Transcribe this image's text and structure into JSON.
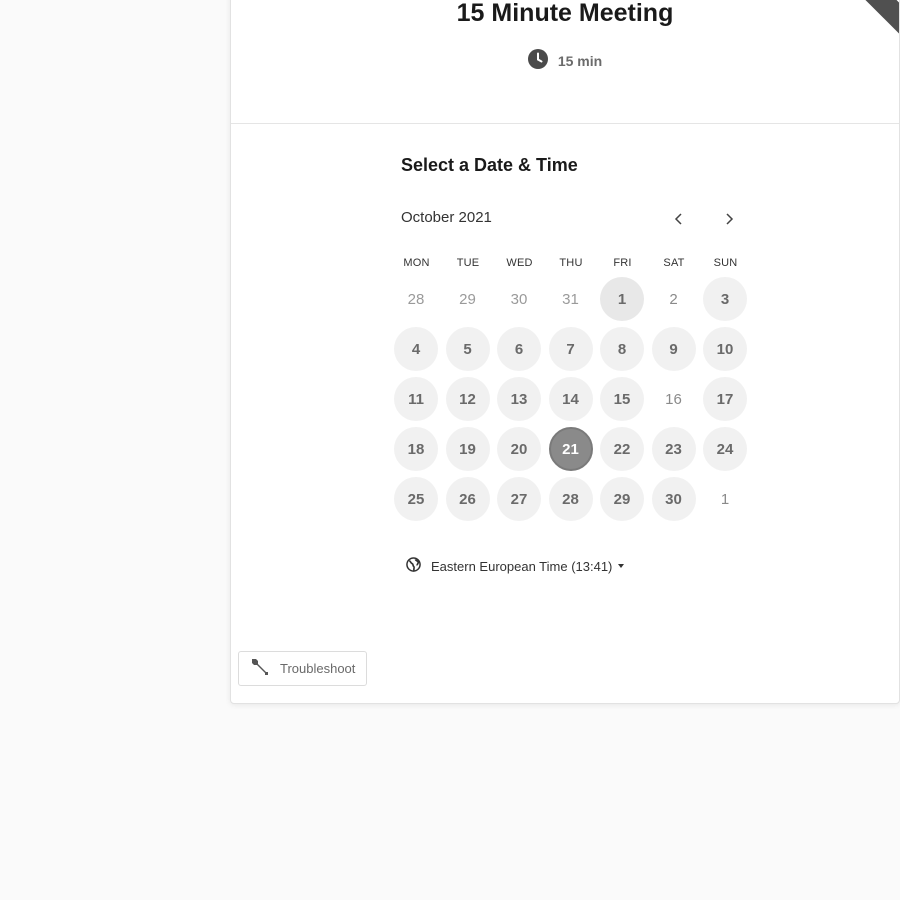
{
  "event": {
    "title": "15 Minute Meeting",
    "duration": "15 min"
  },
  "calendar": {
    "heading": "Select a Date & Time",
    "month_label": "October 2021",
    "weekdays": [
      "MON",
      "TUE",
      "WED",
      "THU",
      "FRI",
      "SAT",
      "SUN"
    ],
    "rows": [
      [
        {
          "d": "28",
          "s": "out"
        },
        {
          "d": "29",
          "s": "out"
        },
        {
          "d": "30",
          "s": "out"
        },
        {
          "d": "31",
          "s": "out"
        },
        {
          "d": "1",
          "s": "today"
        },
        {
          "d": "2",
          "s": "plain"
        },
        {
          "d": "3",
          "s": "avail"
        }
      ],
      [
        {
          "d": "4",
          "s": "avail"
        },
        {
          "d": "5",
          "s": "avail"
        },
        {
          "d": "6",
          "s": "avail"
        },
        {
          "d": "7",
          "s": "avail"
        },
        {
          "d": "8",
          "s": "avail"
        },
        {
          "d": "9",
          "s": "avail"
        },
        {
          "d": "10",
          "s": "avail"
        }
      ],
      [
        {
          "d": "11",
          "s": "avail"
        },
        {
          "d": "12",
          "s": "avail"
        },
        {
          "d": "13",
          "s": "avail"
        },
        {
          "d": "14",
          "s": "avail"
        },
        {
          "d": "15",
          "s": "avail"
        },
        {
          "d": "16",
          "s": "plain"
        },
        {
          "d": "17",
          "s": "avail"
        }
      ],
      [
        {
          "d": "18",
          "s": "avail"
        },
        {
          "d": "19",
          "s": "avail"
        },
        {
          "d": "20",
          "s": "avail"
        },
        {
          "d": "21",
          "s": "selected"
        },
        {
          "d": "22",
          "s": "avail"
        },
        {
          "d": "23",
          "s": "avail"
        },
        {
          "d": "24",
          "s": "avail"
        }
      ],
      [
        {
          "d": "25",
          "s": "avail"
        },
        {
          "d": "26",
          "s": "avail"
        },
        {
          "d": "27",
          "s": "avail"
        },
        {
          "d": "28",
          "s": "avail"
        },
        {
          "d": "29",
          "s": "avail"
        },
        {
          "d": "30",
          "s": "avail"
        },
        {
          "d": "1",
          "s": "plain"
        }
      ]
    ],
    "selected_date": "21"
  },
  "timezone": {
    "label": "Eastern European Time (13:41)"
  },
  "footer": {
    "troubleshoot_label": "Troubleshoot"
  },
  "icons": {
    "clock": "clock-icon",
    "globe": "globe-icon",
    "wrench": "wrench-icon",
    "prev": "chevron-left-icon",
    "next": "chevron-right-icon"
  },
  "colors": {
    "selected_day": "#8a8a8a",
    "available_day": "#f1f1f1",
    "ribbon": "#505050"
  }
}
